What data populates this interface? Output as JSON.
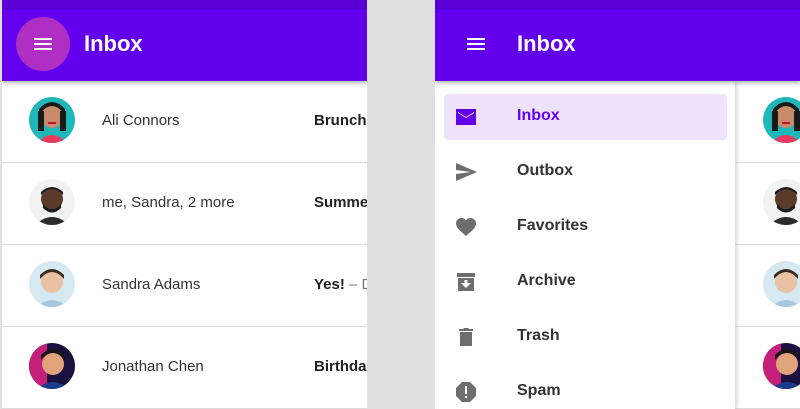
{
  "left_screen": {
    "title": "Inbox",
    "emails": [
      {
        "sender": "Ali Connors",
        "subject": "Brunch",
        "preview": ""
      },
      {
        "sender": "me, Sandra, 2 more",
        "subject": "Summe",
        "preview": ""
      },
      {
        "sender": "Sandra Adams",
        "subject": "Yes!",
        "preview": " – D"
      },
      {
        "sender": "Jonathan Chen",
        "subject": "Birthda",
        "preview": ""
      }
    ]
  },
  "right_screen": {
    "title": "Inbox",
    "drawer": {
      "items": [
        {
          "label": "Inbox",
          "icon": "mail-icon",
          "active": true
        },
        {
          "label": "Outbox",
          "icon": "send-icon",
          "active": false
        },
        {
          "label": "Favorites",
          "icon": "heart-icon",
          "active": false
        },
        {
          "label": "Archive",
          "icon": "archive-icon",
          "active": false
        },
        {
          "label": "Trash",
          "icon": "trash-icon",
          "active": false
        },
        {
          "label": "Spam",
          "icon": "spam-icon",
          "active": false
        }
      ]
    }
  },
  "colors": {
    "primary": "#6200ee",
    "primary_dark": "#5a00d6",
    "menu_ripple": "#b02fc3",
    "active_item_bg": "#efe2fb"
  }
}
